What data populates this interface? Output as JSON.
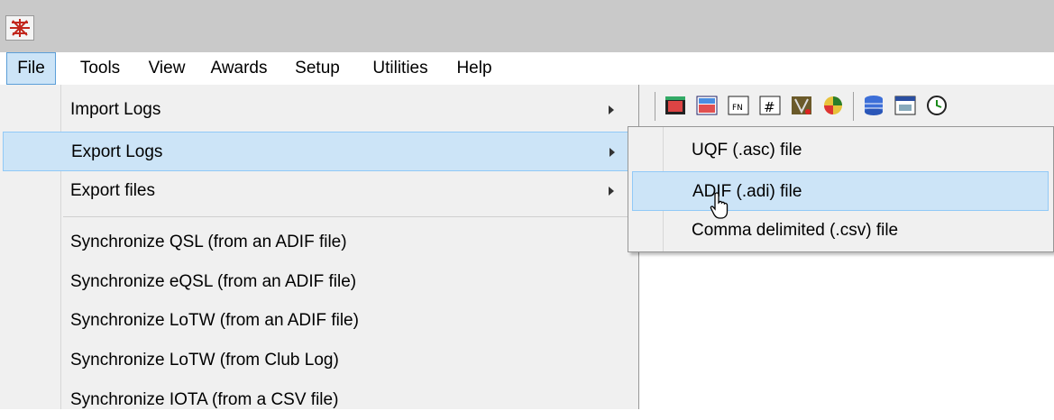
{
  "menubar": {
    "items": [
      "File",
      "Tools",
      "View",
      "Awards",
      "Setup",
      "Utilities",
      "Help"
    ],
    "active": "File"
  },
  "file_menu": {
    "items": [
      {
        "label": "Import Logs",
        "submenu": true
      },
      {
        "label": "Export Logs",
        "submenu": true,
        "highlighted": true
      },
      {
        "label": "Export files",
        "submenu": true
      },
      {
        "label": "Synchronize QSL (from an ADIF file)"
      },
      {
        "label": "Synchronize eQSL (from an ADIF file)"
      },
      {
        "label": "Synchronize LoTW (from an ADIF file)"
      },
      {
        "label": "Synchronize LoTW (from Club Log)"
      },
      {
        "label": "Synchronize IOTA (from a CSV file)"
      }
    ]
  },
  "export_submenu": {
    "items": [
      {
        "label": "UQF (.asc) file"
      },
      {
        "label": "ADIF (.adi) file",
        "highlighted": true
      },
      {
        "label": "Comma delimited (.csv) file"
      }
    ]
  },
  "toolbar": {
    "icons": [
      "window-icon",
      "chart-icon",
      "fn-icon",
      "hash-icon",
      "antenna-icon",
      "globe-icon",
      "database-icon",
      "calendar-icon",
      "clock-icon"
    ]
  },
  "colors": {
    "highlight": "#cce4f7",
    "highlight_border": "#91c9f7",
    "menu_bg": "#f0f0f0",
    "titlebar": "#c9c9c9"
  }
}
